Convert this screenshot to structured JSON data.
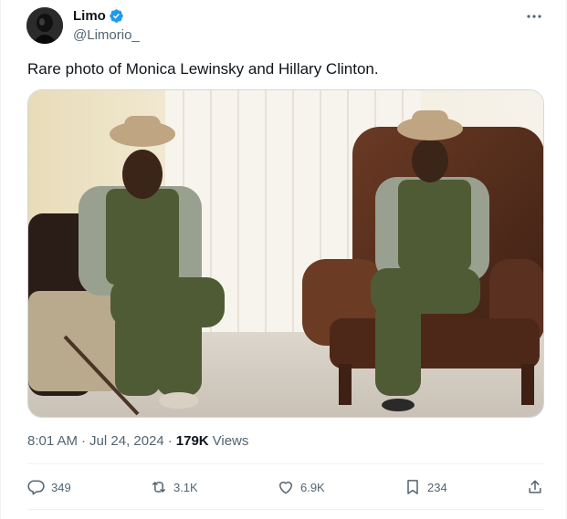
{
  "author": {
    "display_name": "Limo",
    "handle": "@Limorio_"
  },
  "tweet": {
    "text": "Rare photo of Monica Lewinsky and Hillary Clinton.",
    "time": "8:01 AM",
    "date": "Jul 24, 2024",
    "views_count": "179K",
    "views_label": "Views"
  },
  "actions": {
    "replies": "349",
    "reposts": "3.1K",
    "likes": "6.9K",
    "bookmarks": "234"
  },
  "colors": {
    "verified": "#1d9bf0",
    "secondary_text": "#536471",
    "primary_text": "#0f1419"
  }
}
